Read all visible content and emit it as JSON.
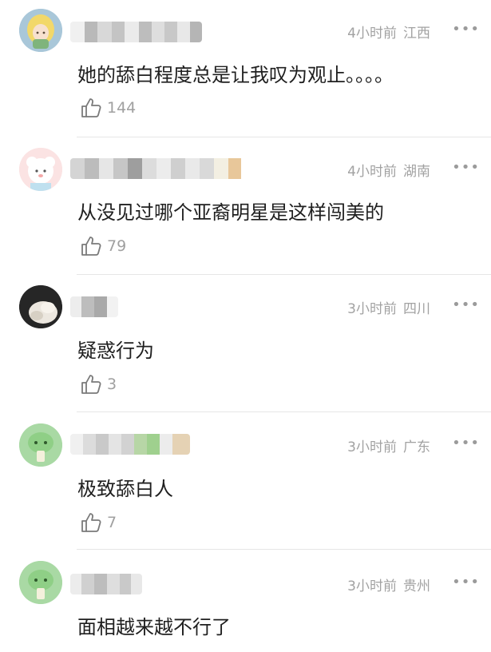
{
  "comments": [
    {
      "time": "4小时前",
      "location": "江西",
      "text": "她的舔白程度总是让我叹为观止。。。。",
      "likes": "144",
      "more": "•••"
    },
    {
      "time": "4小时前",
      "location": "湖南",
      "text": "从没见过哪个亚裔明星是这样闯美的",
      "likes": "79",
      "more": "•••"
    },
    {
      "time": "3小时前",
      "location": "四川",
      "text": "疑惑行为",
      "likes": "3",
      "more": "•••"
    },
    {
      "time": "3小时前",
      "location": "广东",
      "text": "极致舔白人",
      "likes": "7",
      "more": "•••"
    },
    {
      "time": "3小时前",
      "location": "贵州",
      "text": "面相越来越不行了",
      "more": "•••"
    }
  ],
  "icons": {
    "like": "thumbs-up-icon",
    "more": "more-dots-icon"
  },
  "colors": {
    "meta_text": "#a2a2a2",
    "body_text": "#1f1f1f",
    "divider": "#e6e6e6"
  }
}
